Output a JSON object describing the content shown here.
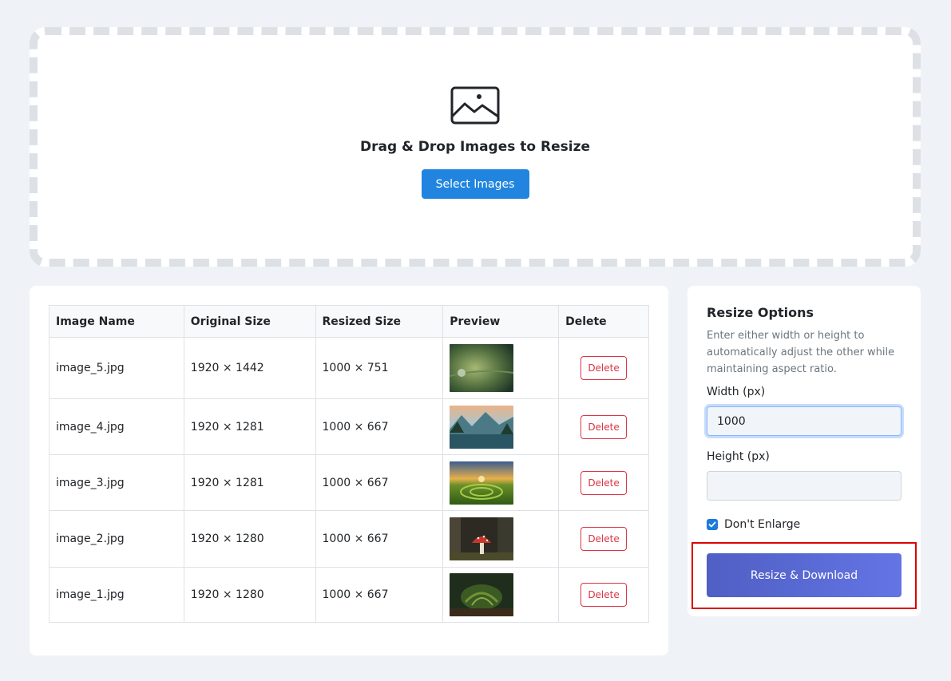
{
  "dropzone": {
    "icon": "image-icon",
    "title": "Drag & Drop Images to Resize",
    "select_label": "Select Images"
  },
  "table": {
    "headers": [
      "Image Name",
      "Original Size",
      "Resized Size",
      "Preview",
      "Delete"
    ],
    "rows": [
      {
        "name": "image_5.jpg",
        "original": "1920 × 1442",
        "resized": "1000 × 751",
        "preview": "water-droplet-thumbnail",
        "delete_label": "Delete"
      },
      {
        "name": "image_4.jpg",
        "original": "1920 × 1281",
        "resized": "1000 × 667",
        "preview": "mountain-lake-thumbnail",
        "delete_label": "Delete"
      },
      {
        "name": "image_3.jpg",
        "original": "1920 × 1281",
        "resized": "1000 × 667",
        "preview": "green-field-sunset-thumbnail",
        "delete_label": "Delete"
      },
      {
        "name": "image_2.jpg",
        "original": "1920 × 1280",
        "resized": "1000 × 667",
        "preview": "red-mushroom-thumbnail",
        "delete_label": "Delete"
      },
      {
        "name": "image_1.jpg",
        "original": "1920 × 1280",
        "resized": "1000 × 667",
        "preview": "fern-forest-thumbnail",
        "delete_label": "Delete"
      }
    ]
  },
  "options": {
    "title": "Resize Options",
    "description": "Enter either width or height to automatically adjust the other while maintaining aspect ratio.",
    "width_label": "Width (px)",
    "width_value": "1000",
    "height_label": "Height (px)",
    "height_value": "",
    "dont_enlarge_label": "Don't Enlarge",
    "dont_enlarge_checked": true,
    "resize_label": "Resize & Download"
  },
  "colors": {
    "primary": "#2185e0",
    "danger": "#dc3545",
    "resize_start": "#4f5fc4",
    "resize_end": "#6474e4",
    "highlight": "#dd0000"
  }
}
